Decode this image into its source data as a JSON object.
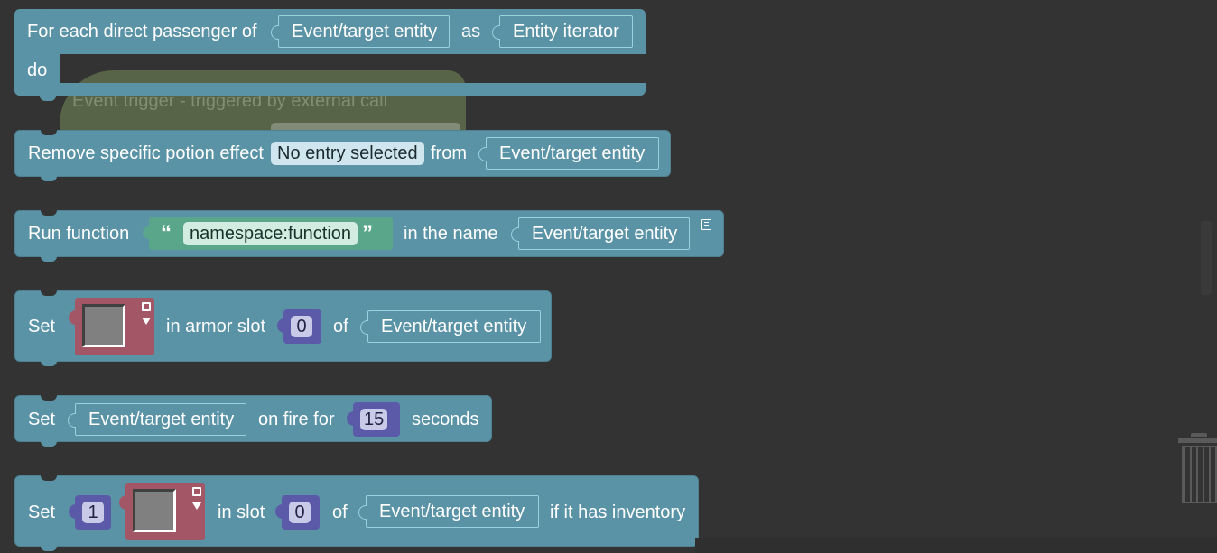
{
  "blocks": {
    "foreach": {
      "label": "For each direct passenger of",
      "entity": "Event/target entity",
      "as": "as",
      "iterator": "Entity iterator",
      "do": "do"
    },
    "hidden": {
      "title": "Event trigger - triggered by external call",
      "color": "#6b7a52"
    },
    "remove_potion": {
      "label": "Remove specific potion effect",
      "effect": "No entry selected",
      "from": "from",
      "entity": "Event/target entity"
    },
    "run_function": {
      "label": "Run function",
      "function": "namespace:function",
      "in_name": "in the name",
      "entity": "Event/target entity",
      "open_quote": "66",
      "close_quote": "99"
    },
    "set_armor": {
      "set": "Set",
      "in_armor_slot": "in armor slot",
      "slot": "0",
      "of": "of",
      "entity": "Event/target entity"
    },
    "set_fire": {
      "set": "Set",
      "entity": "Event/target entity",
      "on_fire_for": "on fire for",
      "seconds_value": "15",
      "seconds": "seconds"
    },
    "set_slot": {
      "set": "Set",
      "amount": "1",
      "in_slot": "in slot",
      "slot": "0",
      "of": "of",
      "entity": "Event/target entity",
      "if_inventory": "if it has inventory"
    }
  },
  "colors": {
    "background": "#333333",
    "block": "#5b93a6",
    "item": "#a35766",
    "number": "#5a5aa8",
    "string": "#5aa68a"
  },
  "icons": [
    "comment-icon",
    "trash-icon"
  ]
}
